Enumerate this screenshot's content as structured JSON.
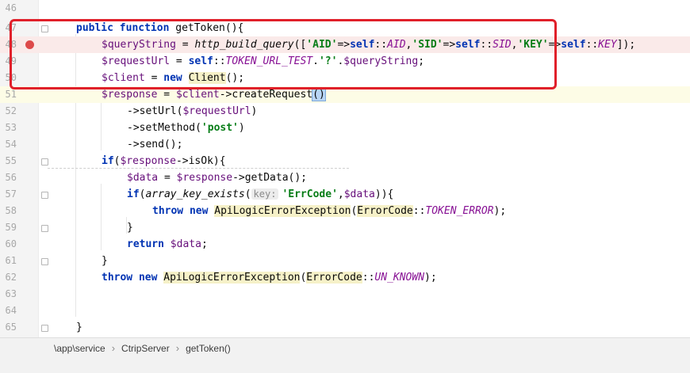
{
  "editor": {
    "lines": [
      {
        "num": "46"
      },
      {
        "num": "47"
      },
      {
        "num": "48"
      },
      {
        "num": "49"
      },
      {
        "num": "50"
      },
      {
        "num": "51"
      },
      {
        "num": "52"
      },
      {
        "num": "53"
      },
      {
        "num": "54"
      },
      {
        "num": "55"
      },
      {
        "num": "56"
      },
      {
        "num": "57"
      },
      {
        "num": "58"
      },
      {
        "num": "59"
      },
      {
        "num": "60"
      },
      {
        "num": "61"
      },
      {
        "num": "62"
      },
      {
        "num": "63"
      },
      {
        "num": "64"
      },
      {
        "num": "65"
      }
    ],
    "code": {
      "l47": {
        "t1": "public",
        "t2": " ",
        "t3": "function",
        "t4": " getToken(){"
      },
      "l48": {
        "t1": "$queryString",
        "t2": " = ",
        "t3": "http_build_query",
        "t4": "([",
        "t5": "'AID'",
        "t6": "=>",
        "t7": "self",
        "t8": "::",
        "t9": "AID",
        "t10": ",",
        "t11": "'SID'",
        "t12": "=>",
        "t13": "self",
        "t14": "::",
        "t15": "SID",
        "t16": ",",
        "t17": "'KEY'",
        "t18": "=>",
        "t19": "self",
        "t20": "::",
        "t21": "KEY",
        "t22": "]);"
      },
      "l49": {
        "t1": "$requestUrl",
        "t2": " = ",
        "t3": "self",
        "t4": "::",
        "t5": "TOKEN_URL_TEST",
        "t6": ".",
        "t7": "'?'",
        "t8": ".",
        "t9": "$queryString",
        "t10": ";"
      },
      "l50": {
        "t1": "$client",
        "t2": " = ",
        "t3": "new",
        "t4": " ",
        "t5": "Client",
        "t6": "();"
      },
      "l51": {
        "t1": "$response",
        "t2": " = ",
        "t3": "$client",
        "t4": "->createRequest",
        "t5": "()"
      },
      "l52": {
        "t1": "->setUrl(",
        "t2": "$requestUrl",
        "t3": ")"
      },
      "l53": {
        "t1": "->setMethod(",
        "t2": "'post'",
        "t3": ")"
      },
      "l54": {
        "t1": "->send();"
      },
      "l55": {
        "t1": "if",
        "t2": "(",
        "t3": "$response",
        "t4": "->isOk){"
      },
      "l56": {
        "t1": "$data",
        "t2": " = ",
        "t3": "$response",
        "t4": "->getData();"
      },
      "l57": {
        "t1": "if",
        "t2": "(",
        "t3": "array_key_exists",
        "t4": "(",
        "t5": "key:",
        "t6": "'ErrCode'",
        "t7": ",",
        "t8": "$data",
        "t9": ")){"
      },
      "l58": {
        "t1": "throw",
        "t2": " ",
        "t3": "new",
        "t4": " ",
        "t5": "ApiLogicErrorException",
        "t6": "(",
        "t7": "ErrorCode",
        "t8": "::",
        "t9": "TOKEN_ERROR",
        "t10": ");"
      },
      "l59": {
        "t1": "}"
      },
      "l60": {
        "t1": "return",
        "t2": " ",
        "t3": "$data",
        "t4": ";"
      },
      "l61": {
        "t1": "}"
      },
      "l62": {
        "t1": "throw",
        "t2": " ",
        "t3": "new",
        "t4": " ",
        "t5": "ApiLogicErrorException",
        "t6": "(",
        "t7": "ErrorCode",
        "t8": "::",
        "t9": "UN_KNOWN",
        "t10": ");"
      },
      "l65": {
        "t1": "}"
      }
    }
  },
  "breadcrumb": {
    "items": [
      "\\app\\service",
      "CtripServer",
      "getToken()"
    ],
    "separator": "›"
  },
  "colors": {
    "keyword": "#0033b3",
    "variable": "#660e7a",
    "string": "#067d17",
    "constant": "#871094",
    "annotation_box": "#e0202a",
    "breakpoint": "#dd4a4a"
  }
}
